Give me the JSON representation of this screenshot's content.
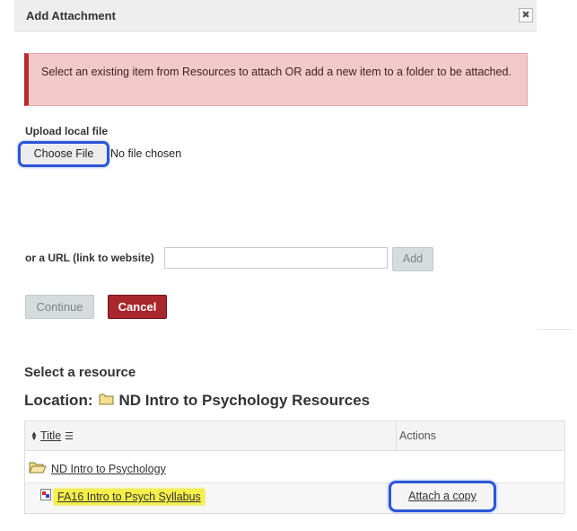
{
  "dialog": {
    "title": "Add Attachment",
    "close_symbol": "✖"
  },
  "alert": {
    "message": "Select an existing item from Resources to attach OR add a new item to a folder to be attached."
  },
  "upload": {
    "label": "Upload local file",
    "button_label": "Choose File",
    "status_text": "No file chosen"
  },
  "url": {
    "label": "or a URL (link to website)",
    "value": "",
    "add_label": "Add"
  },
  "actions": {
    "continue_label": "Continue",
    "cancel_label": "Cancel"
  },
  "resource": {
    "heading": "Select a resource",
    "location_label": "Location:",
    "location_name": "ND Intro to Psychology Resources"
  },
  "table": {
    "col_title": "Title",
    "col_actions": "Actions",
    "folder_name": "ND Intro to Psychology",
    "file_name": "FA16 Intro to Psych Syllabus",
    "attach_label": "Attach a copy"
  },
  "colors": {
    "alert_bg": "#f2c9c9",
    "alert_border": "#b72a2a",
    "highlight_ring": "#2b56d6",
    "cancel_bg": "#a8272c",
    "file_highlight": "#f4ef4a"
  },
  "icons": {
    "close": "close-icon",
    "sort": "sort-icon",
    "filter": "filter-icon",
    "folder": "folder-icon",
    "open_folder": "open-folder-icon",
    "file": "file-icon"
  }
}
